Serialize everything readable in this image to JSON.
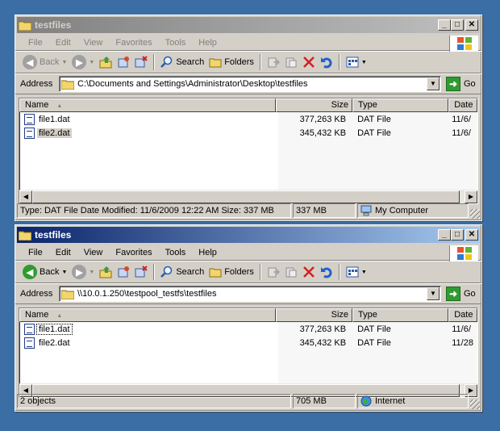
{
  "colors": {
    "desktop": "#3a6ea5",
    "title_active": "#0a246a",
    "title_inactive": "#808080",
    "chrome": "#d4d0c8"
  },
  "menu_labels": [
    "File",
    "Edit",
    "View",
    "Favorites",
    "Tools",
    "Help"
  ],
  "toolbar": {
    "back_label": "Back",
    "search_label": "Search",
    "folders_label": "Folders",
    "address_label": "Address",
    "go_label": "Go"
  },
  "columns": {
    "name": "Name",
    "size": "Size",
    "type": "Type",
    "date": "Date"
  },
  "window1": {
    "title": "testfiles",
    "state": "inactive",
    "address": "C:\\Documents and Settings\\Administrator\\Desktop\\testfiles",
    "files": [
      {
        "name": "file1.dat",
        "size": "377,263 KB",
        "type": "DAT File",
        "date": "11/6/"
      },
      {
        "name": "file2.dat",
        "size": "345,432 KB",
        "type": "DAT File",
        "date": "11/6/"
      }
    ],
    "status": {
      "info": "Type: DAT File Date Modified: 11/6/2009 12:22 AM Size: 337 MB",
      "size": "337 MB",
      "zone": "My Computer"
    }
  },
  "window2": {
    "title": "testfiles",
    "state": "active",
    "address": "\\\\10.0.1.250\\testpool_testfs\\testfiles",
    "files": [
      {
        "name": "file1.dat",
        "size": "377,263 KB",
        "type": "DAT File",
        "date": "11/6/"
      },
      {
        "name": "file2.dat",
        "size": "345,432 KB",
        "type": "DAT File",
        "date": "11/28"
      }
    ],
    "status": {
      "info": "2 objects",
      "size": "705 MB",
      "zone": "Internet"
    }
  }
}
